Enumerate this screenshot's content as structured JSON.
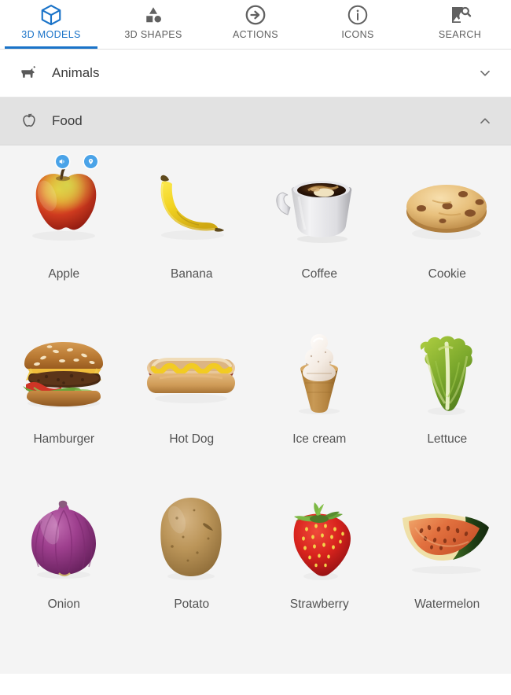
{
  "tabs": [
    {
      "label": "3D MODELS",
      "icon": "cube-icon",
      "active": true
    },
    {
      "label": "3D SHAPES",
      "icon": "shapes-icon",
      "active": false
    },
    {
      "label": "ACTIONS",
      "icon": "arrow-circle-icon",
      "active": false
    },
    {
      "label": "ICONS",
      "icon": "info-circle-icon",
      "active": false
    },
    {
      "label": "SEARCH",
      "icon": "image-search-icon",
      "active": false
    }
  ],
  "sections": [
    {
      "title": "Animals",
      "icon": "dog-icon",
      "expanded": false,
      "chevron": "chevron-down-icon",
      "state": "collapsed"
    },
    {
      "title": "Food",
      "icon": "apple-outline-icon",
      "expanded": true,
      "chevron": "chevron-up-icon",
      "state": "expanded"
    }
  ],
  "grid": {
    "items": [
      {
        "label": "Apple",
        "model": "apple-3d-model",
        "badges": [
          "sound-badge-icon",
          "animation-badge-icon"
        ]
      },
      {
        "label": "Banana",
        "model": "banana-3d-model",
        "badges": []
      },
      {
        "label": "Coffee",
        "model": "coffee-3d-model",
        "badges": []
      },
      {
        "label": "Cookie",
        "model": "cookie-3d-model",
        "badges": []
      },
      {
        "label": "Hamburger",
        "model": "hamburger-3d-model",
        "badges": []
      },
      {
        "label": "Hot Dog",
        "model": "hot-dog-3d-model",
        "badges": []
      },
      {
        "label": "Ice cream",
        "model": "ice-cream-3d-model",
        "badges": []
      },
      {
        "label": "Lettuce",
        "model": "lettuce-3d-model",
        "badges": []
      },
      {
        "label": "Onion",
        "model": "onion-3d-model",
        "badges": []
      },
      {
        "label": "Potato",
        "model": "potato-3d-model",
        "badges": []
      },
      {
        "label": "Strawberry",
        "model": "strawberry-3d-model",
        "badges": []
      },
      {
        "label": "Watermelon",
        "model": "watermelon-3d-model",
        "badges": []
      }
    ]
  },
  "colors": {
    "accent": "#1a73c8",
    "tab_inactive_text": "#606060",
    "section_text": "#3c3c3c",
    "section_grey_bg": "#e2e2e2",
    "grid_bg": "#f4f4f4",
    "label_text": "#535353",
    "badge_blue": "#4aa3e8"
  }
}
